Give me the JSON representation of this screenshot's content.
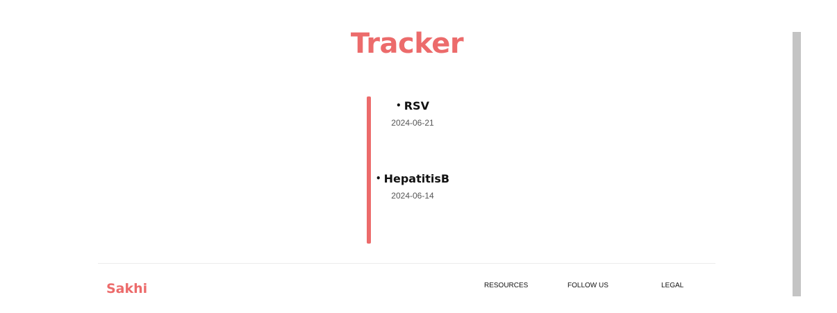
{
  "page": {
    "title": "Tracker"
  },
  "timeline": {
    "items": [
      {
        "bullet": "•",
        "name": "RSV",
        "date": "2024-06-21"
      },
      {
        "bullet": "•",
        "name": "HepatitisB",
        "date": "2024-06-14"
      }
    ]
  },
  "footer": {
    "brand": "Sakhi",
    "links": [
      "RESOURCES",
      "FOLLOW US",
      "LEGAL"
    ]
  },
  "colors": {
    "accent": "#ec6b6b",
    "scrollbar": "#c4c4c4"
  }
}
